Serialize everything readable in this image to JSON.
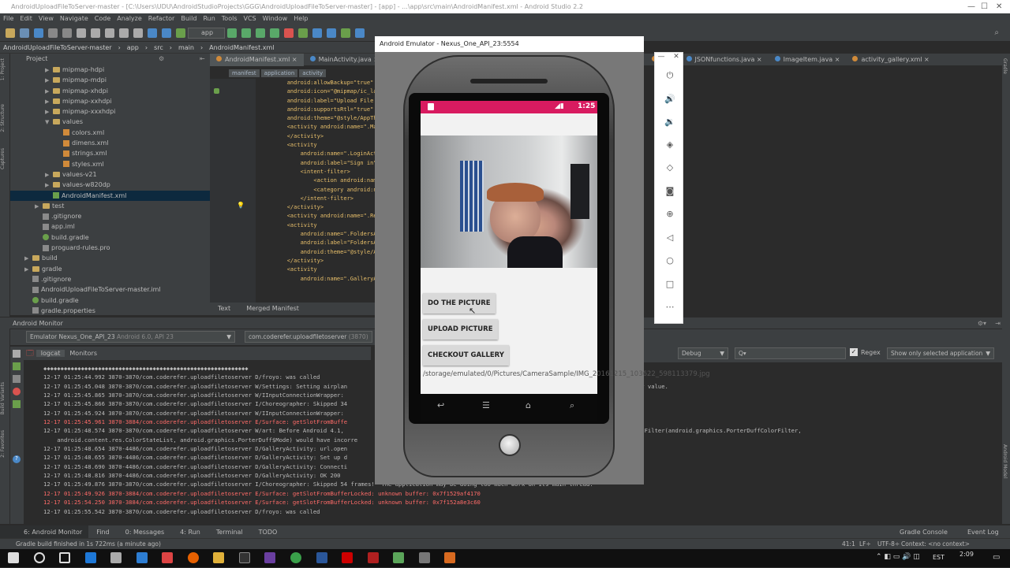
{
  "window": {
    "title": "AndroidUploadFileToServer-master - [C:\\Users\\UDU\\AndroidStudioProjects\\GGG\\AndroidUploadFileToServer-master] - [app] - ...\\app\\src\\main\\AndroidManifest.xml - Android Studio 2.2"
  },
  "menu": [
    "File",
    "Edit",
    "View",
    "Navigate",
    "Code",
    "Analyze",
    "Refactor",
    "Build",
    "Run",
    "Tools",
    "VCS",
    "Window",
    "Help"
  ],
  "toolbar": {
    "run_config": "app"
  },
  "breadcrumb": [
    "AndroidUploadFileToServer-master",
    "app",
    "src",
    "main",
    "AndroidManifest.xml"
  ],
  "project": {
    "header": "Project",
    "items": [
      {
        "label": "mipmap-hdpi",
        "type": "folder",
        "indent": 3,
        "arrow": "▶"
      },
      {
        "label": "mipmap-mdpi",
        "type": "folder",
        "indent": 3,
        "arrow": "▶"
      },
      {
        "label": "mipmap-xhdpi",
        "type": "folder",
        "indent": 3,
        "arrow": "▶"
      },
      {
        "label": "mipmap-xxhdpi",
        "type": "folder",
        "indent": 3,
        "arrow": "▶"
      },
      {
        "label": "mipmap-xxxhdpi",
        "type": "folder",
        "indent": 3,
        "arrow": "▶"
      },
      {
        "label": "values",
        "type": "folder",
        "indent": 3,
        "arrow": "▼"
      },
      {
        "label": "colors.xml",
        "type": "xml",
        "indent": 4,
        "arrow": ""
      },
      {
        "label": "dimens.xml",
        "type": "xml",
        "indent": 4,
        "arrow": ""
      },
      {
        "label": "strings.xml",
        "type": "xml",
        "indent": 4,
        "arrow": ""
      },
      {
        "label": "styles.xml",
        "type": "xml",
        "indent": 4,
        "arrow": ""
      },
      {
        "label": "values-v21",
        "type": "folder",
        "indent": 3,
        "arrow": "▶"
      },
      {
        "label": "values-w820dp",
        "type": "folder",
        "indent": 3,
        "arrow": "▶"
      },
      {
        "label": "AndroidManifest.xml",
        "type": "manifest",
        "indent": 3,
        "arrow": "",
        "selected": true
      },
      {
        "label": "test",
        "type": "folder",
        "indent": 2,
        "arrow": "▶"
      },
      {
        "label": ".gitignore",
        "type": "file",
        "indent": 2,
        "arrow": ""
      },
      {
        "label": "app.iml",
        "type": "file",
        "indent": 2,
        "arrow": ""
      },
      {
        "label": "build.gradle",
        "type": "gradle",
        "indent": 2,
        "arrow": ""
      },
      {
        "label": "proguard-rules.pro",
        "type": "file",
        "indent": 2,
        "arrow": ""
      },
      {
        "label": "build",
        "type": "folder",
        "indent": 1,
        "arrow": "▶"
      },
      {
        "label": "gradle",
        "type": "folder",
        "indent": 1,
        "arrow": "▶"
      },
      {
        "label": ".gitignore",
        "type": "file",
        "indent": 1,
        "arrow": ""
      },
      {
        "label": "AndroidUploadFileToServer-master.iml",
        "type": "file",
        "indent": 1,
        "arrow": ""
      },
      {
        "label": "build.gradle",
        "type": "gradle",
        "indent": 1,
        "arrow": ""
      },
      {
        "label": "gradle.properties",
        "type": "file",
        "indent": 1,
        "arrow": ""
      }
    ]
  },
  "editor_tabs": [
    "AndroidManifest.xml",
    "MainActivity.java",
    "gal",
    "JSONfunctions.java",
    "ImageItem.java",
    "activity_gallery.xml"
  ],
  "xml_crumbs": [
    "manifest",
    "application",
    "activity"
  ],
  "code_lines": [
    {
      "t": "        android:allowBackup=\"true\""
    },
    {
      "t": "        android:icon=\"@mipmap/ic_launch"
    },
    {
      "t": "        android:label=\"Upload File To S"
    },
    {
      "t": "        android:supportsRtl=\"true\""
    },
    {
      "t": "        android:theme=\"@style/AppTheme\""
    },
    {
      "t": "        <activity android:name=\".MainAct"
    },
    {
      "t": ""
    },
    {
      "t": "        </activity>"
    },
    {
      "t": "        <activity"
    },
    {
      "t": "            android:name=\".LoginActivit"
    },
    {
      "t": "            android:label=\"Sign in\" >"
    },
    {
      "t": "            <intent-filter>"
    },
    {
      "t": "                <action android:name=\""
    },
    {
      "t": "                <category android:name="
    },
    {
      "t": "            </intent-filter>"
    },
    {
      "t": ""
    },
    {
      "t": "        </activity>"
    },
    {
      "t": "        <activity android:name=\".Regist"
    },
    {
      "t": "        <activity"
    },
    {
      "t": "            android:name=\".FoldersActiv"
    },
    {
      "t": "            android:label=\"FoldersActiv"
    },
    {
      "t": "            android:theme=\"@style/AppTh"
    },
    {
      "t": "        </activity>"
    },
    {
      "t": "        <activity"
    },
    {
      "t": "            android:name=\".GalleryActiv"
    }
  ],
  "editor_bottom_tabs": [
    "Text",
    "Merged Manifest"
  ],
  "monitor": {
    "title": "Android Monitor",
    "device": "Emulator Nexus_One_API_23",
    "device_detail": "Android 6.0, API 23",
    "process": "com.coderefer.uploadfiletoserver",
    "process_bold": "uploadfiletoserver",
    "pid": "(3870)",
    "tabs": [
      "logcat",
      "Monitors"
    ],
    "level": "Debug",
    "search_placeholder": "Q▾",
    "regex_label": "Regex",
    "filter": "Show only selected application"
  },
  "logcat": [
    {
      "lvl": "i",
      "t": "◆◆◆◆◆◆◆◆◆◆◆◆◆◆◆◆◆◆◆◆◆◆◆◆◆◆◆◆◆◆◆◆◆◆◆◆◆◆◆◆◆◆◆◆◆◆◆◆◆◆◆◆◆◆◆◆◆◆◆◆"
    },
    {
      "lvl": "i",
      "t": "12-17 01:25:44.992 3870-3870/com.coderefer.uploadfiletoserver D/froyo: was called"
    },
    {
      "lvl": "i",
      "t": "12-17 01:25:45.048 3870-3870/com.coderefer.uploadfiletoserver W/Settings: Setting airplan                                              ider.Settings.Global, returning read-only value."
    },
    {
      "lvl": "i",
      "t": "12-17 01:25:45.865 3870-3870/com.coderefer.uploadfiletoserver W/IInputConnectionWrapper:"
    },
    {
      "lvl": "i",
      "t": "12-17 01:25:45.866 3870-3870/com.coderefer.uploadfiletoserver I/Choreographer: Skipped 34"
    },
    {
      "lvl": "i",
      "t": "12-17 01:25:45.924 3870-3870/com.coderefer.uploadfiletoserver W/IInputConnectionWrapper:"
    },
    {
      "lvl": "e",
      "t": "12-17 01:25:45.961 3870-3884/com.coderefer.uploadfiletoserver E/Surface: getSlotFromBuffe"
    },
    {
      "lvl": "i",
      "t": "12-17 01:25:48.574 3870-3870/com.coderefer.uploadfiletoserver W/art: Before Android 4.1,                                                  awable.VectorDrawableCompat.updateTintFilter(android.graphics.PorterDuffColorFilter,"
    },
    {
      "lvl": "i",
      "t": "    android.content.res.ColorStateList, android.graphics.PorterDuff$Mode) would have incorre                                              rawable"
    },
    {
      "lvl": "i",
      "t": "12-17 01:25:48.654 3870-4486/com.coderefer.uploadfiletoserver D/GalleryActivity: url.open"
    },
    {
      "lvl": "i",
      "t": "12-17 01:25:48.655 3870-4486/com.coderefer.uploadfiletoserver D/GalleryActivity: Set up d"
    },
    {
      "lvl": "i",
      "t": "12-17 01:25:48.690 3870-4486/com.coderefer.uploadfiletoserver D/GalleryActivity: Connecti"
    },
    {
      "lvl": "i",
      "t": "12-17 01:25:48.816 3870-4486/com.coderefer.uploadfiletoserver D/GalleryActivity: OK 200"
    },
    {
      "lvl": "i",
      "t": "12-17 01:25:49.876 3870-3870/com.coderefer.uploadfiletoserver I/Choreographer: Skipped 54 frames!  The application may be doing too much work on its main thread."
    },
    {
      "lvl": "e",
      "t": "12-17 01:25:49.926 3870-3884/com.coderefer.uploadfiletoserver E/Surface: getSlotFromBufferLocked: unknown buffer: 0x7f1529af4170"
    },
    {
      "lvl": "e",
      "t": "12-17 01:25:54.250 3870-3884/com.coderefer.uploadfiletoserver E/Surface: getSlotFromBufferLocked: unknown buffer: 0x7f152a8e3c60"
    },
    {
      "lvl": "i",
      "t": "12-17 01:25:55.542 3870-3870/com.coderefer.uploadfiletoserver D/froyo: was called"
    }
  ],
  "bottom_tabs": [
    "6: Android Monitor",
    "Find",
    "0: Messages",
    "4: Run",
    "Terminal",
    "TODO"
  ],
  "bottom_right_tabs": [
    "Gradle Console",
    "Event Log"
  ],
  "status": {
    "message": "Gradle build finished in 1s 722ms (a minute ago)",
    "position": "41:1",
    "line_sep": "LF÷",
    "encoding": "UTF-8÷",
    "context": "Context: <no context>"
  },
  "emulator": {
    "title": "Android Emulator - Nexus_One_API_23:5554",
    "time": "1:25",
    "buttons": [
      "DO THE PICTURE",
      "UPLOAD PICTURE",
      "CHECKOUT GALLERY"
    ],
    "path": "/storage/emulated/0/Pictures/CameraSample/IMG_20161215_103622_598113379.jpg"
  },
  "side_strip": [
    "1: Project",
    "2: Structure",
    "Captures",
    "Build Variants",
    "2: Favorites"
  ],
  "right_strip": [
    "Gradle",
    "Android Model"
  ],
  "clock": {
    "time": "2:09",
    "lang": "EST"
  },
  "colors": {
    "status_bar": "#d81b60",
    "ide_bg": "#2b2b2b",
    "panel": "#3c3f41",
    "error": "#ff6b68"
  }
}
